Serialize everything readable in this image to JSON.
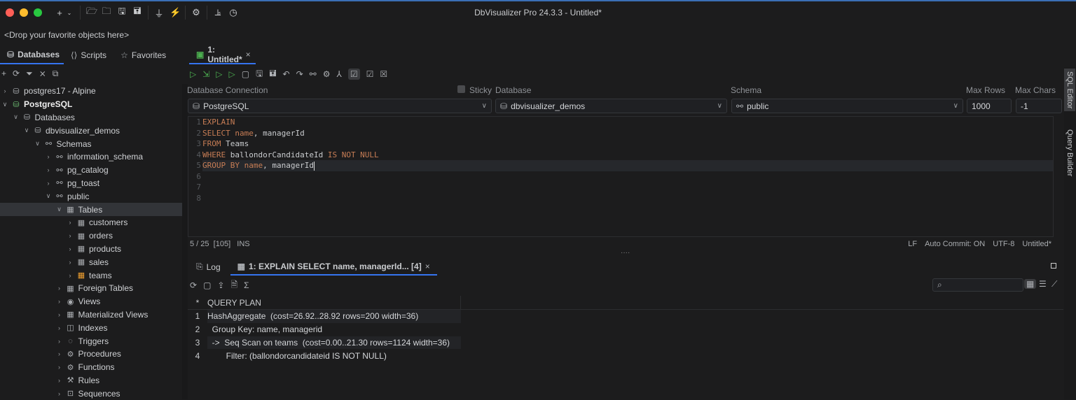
{
  "app": {
    "title": "DbVisualizer Pro 24.3.3 - Untitled*",
    "favorites_placeholder": "<Drop your favorite objects here>"
  },
  "colors": {
    "accent": "#3574f0",
    "keyword": "#c77d55",
    "run": "#4caf50",
    "close": "#ff5f57",
    "minimize": "#febc2e",
    "maximize": "#28c840"
  },
  "nav_tabs": [
    {
      "label": "Databases",
      "icon": "database-icon"
    },
    {
      "label": "Scripts",
      "icon": "script-icon"
    },
    {
      "label": "Favorites",
      "icon": "star-icon"
    }
  ],
  "editor_tab": {
    "label": "1: Untitled*"
  },
  "tree": [
    {
      "label": "postgres17 - Alpine",
      "level": 0,
      "expanded": false,
      "icon": "database-icon"
    },
    {
      "label": "PostgreSQL",
      "level": 0,
      "expanded": true,
      "icon": "database-connected-icon",
      "bold": true
    },
    {
      "label": "Databases",
      "level": 1,
      "expanded": true,
      "icon": "database-icon"
    },
    {
      "label": "dbvisualizer_demos",
      "level": 2,
      "expanded": true,
      "icon": "database-icon"
    },
    {
      "label": "Schemas",
      "level": 3,
      "expanded": true,
      "icon": "schema-icon"
    },
    {
      "label": "information_schema",
      "level": 4,
      "expanded": false,
      "icon": "schema-icon"
    },
    {
      "label": "pg_catalog",
      "level": 4,
      "expanded": false,
      "icon": "schema-icon"
    },
    {
      "label": "pg_toast",
      "level": 4,
      "expanded": false,
      "icon": "schema-icon"
    },
    {
      "label": "public",
      "level": 4,
      "expanded": true,
      "icon": "schema-icon"
    },
    {
      "label": "Tables",
      "level": 5,
      "expanded": true,
      "icon": "table-icon",
      "selected": true
    },
    {
      "label": "customers",
      "level": 6,
      "expanded": false,
      "icon": "table-icon"
    },
    {
      "label": "orders",
      "level": 6,
      "expanded": false,
      "icon": "table-icon"
    },
    {
      "label": "products",
      "level": 6,
      "expanded": false,
      "icon": "table-icon"
    },
    {
      "label": "sales",
      "level": 6,
      "expanded": false,
      "icon": "table-icon"
    },
    {
      "label": "teams",
      "level": 6,
      "expanded": false,
      "icon": "table-modified-icon"
    },
    {
      "label": "Foreign Tables",
      "level": 5,
      "expanded": false,
      "icon": "table-icon"
    },
    {
      "label": "Views",
      "level": 5,
      "expanded": false,
      "icon": "eye-icon"
    },
    {
      "label": "Materialized Views",
      "level": 5,
      "expanded": false,
      "icon": "table-icon"
    },
    {
      "label": "Indexes",
      "level": 5,
      "expanded": false,
      "icon": "index-icon"
    },
    {
      "label": "Triggers",
      "level": 5,
      "expanded": false,
      "icon": "trigger-icon"
    },
    {
      "label": "Procedures",
      "level": 5,
      "expanded": false,
      "icon": "gear-icon"
    },
    {
      "label": "Functions",
      "level": 5,
      "expanded": false,
      "icon": "gear-icon"
    },
    {
      "label": "Rules",
      "level": 5,
      "expanded": false,
      "icon": "hammer-icon"
    },
    {
      "label": "Sequences",
      "level": 5,
      "expanded": false,
      "icon": "sequence-icon"
    }
  ],
  "connection": {
    "db_connection_label": "Database Connection",
    "sticky_label": "Sticky",
    "database_label": "Database",
    "schema_label": "Schema",
    "max_rows_label": "Max Rows",
    "max_chars_label": "Max Chars",
    "connection": "PostgreSQL",
    "database": "dbvisualizer_demos",
    "schema": "public",
    "max_rows": "1000",
    "max_chars": "-1"
  },
  "editor": {
    "lines": [
      [
        {
          "t": "EXPLAIN",
          "k": 1
        }
      ],
      [
        {
          "t": "SELECT ",
          "k": 1
        },
        {
          "t": "name",
          "k": 1
        },
        {
          "t": ", managerId",
          "k": 0
        }
      ],
      [
        {
          "t": "FROM ",
          "k": 1
        },
        {
          "t": "Teams",
          "k": 0
        }
      ],
      [
        {
          "t": "WHERE ",
          "k": 1
        },
        {
          "t": "ballondorCandidateId ",
          "k": 0
        },
        {
          "t": "IS NOT NULL",
          "k": 1
        }
      ],
      [
        {
          "t": "GROUP BY ",
          "k": 1
        },
        {
          "t": "name",
          "k": 1
        },
        {
          "t": ", managerId",
          "k": 0
        }
      ],
      [],
      [],
      []
    ],
    "current_line": 5
  },
  "status": {
    "position": "5 / 25",
    "offset": "[105]",
    "mode": "INS",
    "line_ending": "LF",
    "auto_commit": "Auto Commit: ON",
    "encoding": "UTF-8",
    "file": "Untitled*"
  },
  "result_tabs": [
    {
      "label": "Log",
      "icon": "log-icon"
    },
    {
      "label": "1: EXPLAIN SELECT name, managerId... [4]",
      "icon": "grid-icon",
      "active": true
    }
  ],
  "grid": {
    "header_marker": "*",
    "column": "QUERY PLAN",
    "rows": [
      {
        "n": "1",
        "v": "HashAggregate  (cost=26.92..28.92 rows=200 width=36)"
      },
      {
        "n": "2",
        "v": "  Group Key: name, managerid"
      },
      {
        "n": "3",
        "v": "  ->  Seq Scan on teams  (cost=0.00..21.30 rows=1124 width=36)"
      },
      {
        "n": "4",
        "v": "        Filter: (ballondorcandidateid IS NOT NULL)"
      }
    ]
  },
  "side_tabs": [
    "SQL Editor",
    "Query Builder"
  ],
  "toolbar": {
    "sum_symbol": "Σ"
  }
}
